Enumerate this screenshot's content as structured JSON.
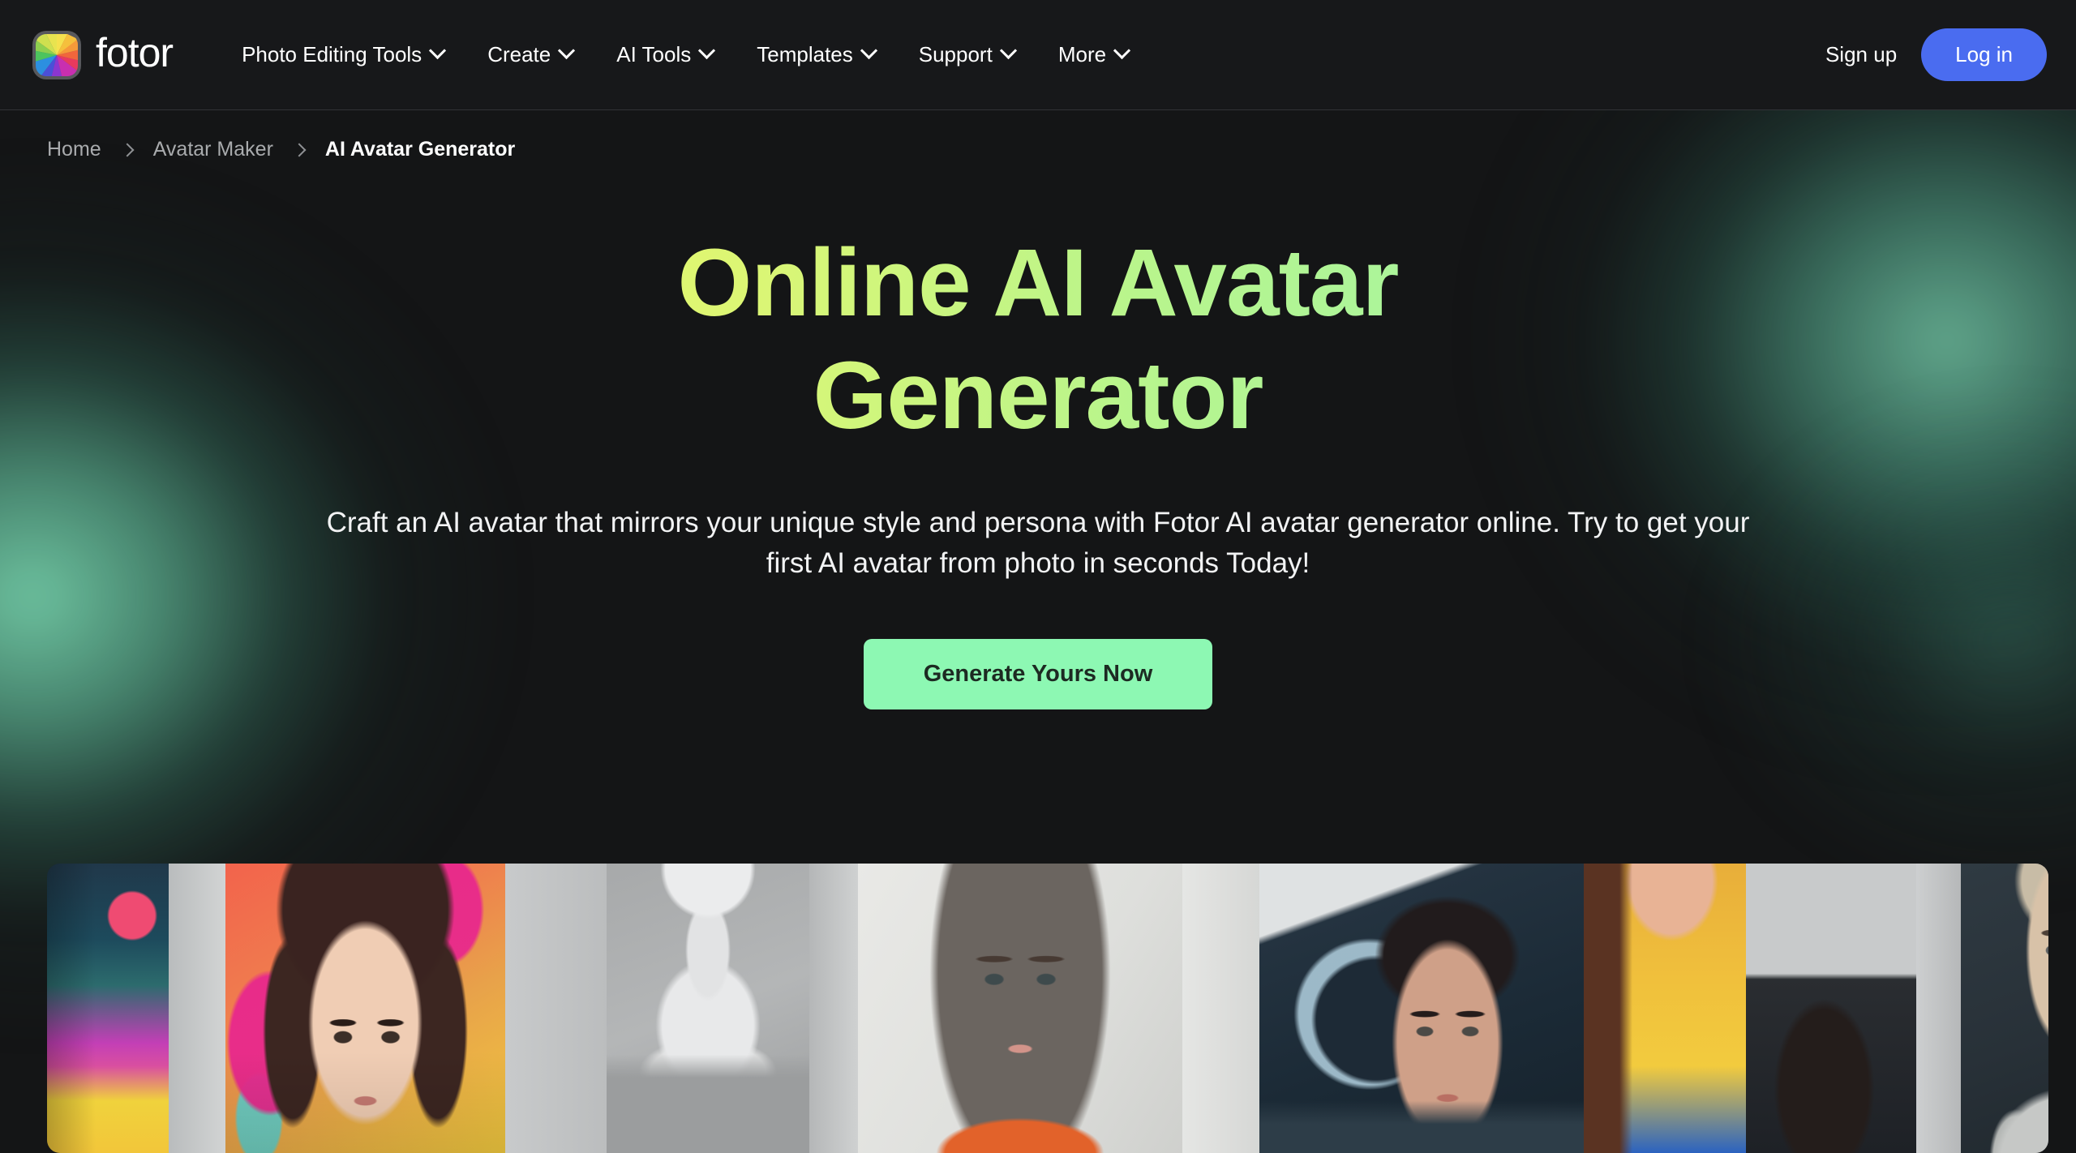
{
  "brand": {
    "name": "fotor",
    "logo_icon": "fotor-color-wheel-icon"
  },
  "nav": {
    "items": [
      {
        "label": "Photo Editing Tools",
        "has_dropdown": true,
        "icon": "chevron-down-icon"
      },
      {
        "label": "Create",
        "has_dropdown": true,
        "icon": "chevron-down-icon"
      },
      {
        "label": "AI Tools",
        "has_dropdown": true,
        "icon": "chevron-down-icon"
      },
      {
        "label": "Templates",
        "has_dropdown": true,
        "icon": "chevron-down-icon"
      },
      {
        "label": "Support",
        "has_dropdown": true,
        "icon": "chevron-down-icon"
      },
      {
        "label": "More",
        "has_dropdown": true,
        "icon": "chevron-down-icon"
      }
    ],
    "signup_label": "Sign up",
    "login_label": "Log in",
    "login_color": "#4a6cf0"
  },
  "breadcrumb": {
    "separator_icon": "chevron-right-icon",
    "items": [
      {
        "label": "Home",
        "current": false
      },
      {
        "label": "Avatar Maker",
        "current": false
      },
      {
        "label": "AI Avatar Generator",
        "current": true
      }
    ]
  },
  "hero": {
    "title_line1": "Online AI Avatar",
    "title_line2": "Generator",
    "title_gradient_from": "#e6f96a",
    "title_gradient_to": "#a3f5a4",
    "description": "Craft an AI avatar that mirrors your unique style and persona with Fotor AI avatar generator online. Try to get your first AI avatar from photo in seconds Today!",
    "cta_label": "Generate Yours Now",
    "cta_color": "#8df8b3",
    "cta_text_color": "#1d2a22"
  },
  "gallery": {
    "name": "ai-avatar-showcase-strip",
    "tiles": [
      {
        "name": "avatar-thumb-abstract-art",
        "alt": "Abstract colorful art panel"
      },
      {
        "name": "avatar-thumb-pink-hair-woman",
        "alt": "Woman with dark hair on pink and orange backdrop"
      },
      {
        "name": "avatar-thumb-marble-bust",
        "alt": "White marble classical bust sculpture"
      },
      {
        "name": "avatar-thumb-longhair-woman",
        "alt": "Long grey-haired woman in orange top"
      },
      {
        "name": "avatar-thumb-scifi-woman",
        "alt": "Sci-fi woman with blue moon backdrop"
      },
      {
        "name": "avatar-thumb-yellow-jacket-woman",
        "alt": "Woman in yellow jacket, pop-art style"
      },
      {
        "name": "avatar-thumb-dark-portrait",
        "alt": "Dark haired portrait"
      },
      {
        "name": "avatar-thumb-silver-armor-woman",
        "alt": "Blonde woman in silver metallic armor"
      }
    ]
  },
  "background": {
    "page_color": "#141516",
    "topbar_color": "#17181a",
    "glow_color": "#76d2ac"
  }
}
